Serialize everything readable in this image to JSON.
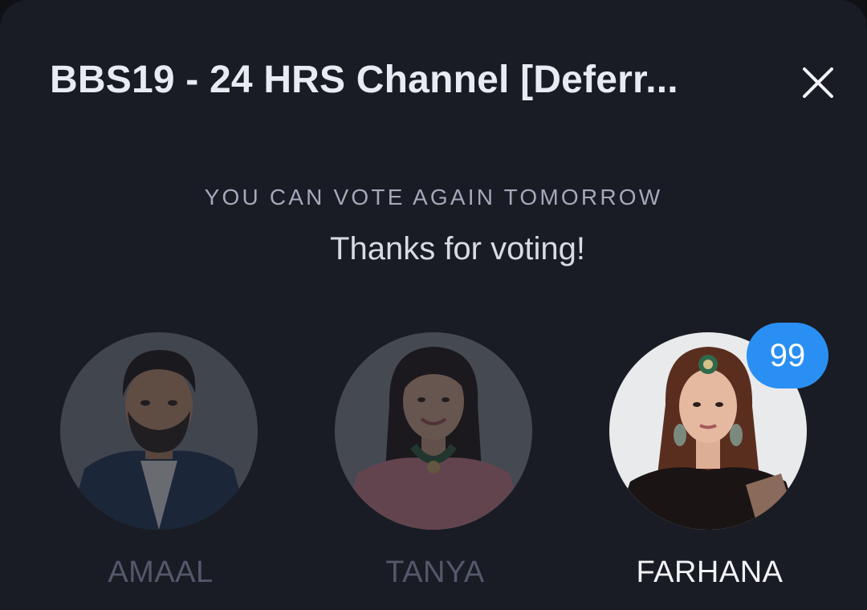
{
  "header": {
    "title": "BBS19 - 24 HRS Channel [Deferr...",
    "close_icon": "close-icon"
  },
  "status": {
    "subheading": "YOU CAN VOTE AGAIN TOMORROW",
    "message": "Thanks for voting!"
  },
  "candidates": [
    {
      "name": "AMAAL",
      "selected": false
    },
    {
      "name": "TANYA",
      "selected": false
    },
    {
      "name": "FARHANA",
      "selected": true,
      "vote_count": "99"
    }
  ],
  "colors": {
    "background": "#191c24",
    "badge": "#2a8ff2",
    "dim_name": "#53586a"
  }
}
